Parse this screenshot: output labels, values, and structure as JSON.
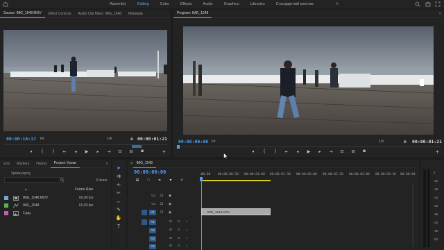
{
  "workspace": {
    "tabs": [
      {
        "label": "Assembly"
      },
      {
        "label": "Editing"
      },
      {
        "label": "Color"
      },
      {
        "label": "Effects"
      },
      {
        "label": "Audio"
      },
      {
        "label": "Graphics"
      },
      {
        "label": "Libraries"
      },
      {
        "label": "Стандартний монтаж"
      }
    ],
    "active_tab": "Editing",
    "more": "»"
  },
  "source": {
    "tabs": [
      "Source: IMG_1548.MOV",
      "Effect Controls",
      "Audio Clip Mixer: IMG_1548",
      "Metadata"
    ],
    "timecode": "00:00:16:17",
    "fit": "Fit",
    "scale": "1/4",
    "duration": "00:00:01:21"
  },
  "program": {
    "tab": "Program: IMG_1548",
    "timecode": "00:00:00:00",
    "fit": "Fit",
    "scale": "1/4",
    "duration": "00:00:01:21"
  },
  "project": {
    "tabs": [
      "ects",
      "Markers",
      "History",
      "Project: Уроки"
    ],
    "project_file": "Уроки.prproj",
    "items_count": "3 Items",
    "column_frame_rate": "Frame Rate",
    "items": [
      {
        "name": "IMG_1548.MOV",
        "frame_rate": "60,00 fps",
        "color": "#6fa9d8"
      },
      {
        "name": "IMG_1548",
        "frame_rate": "60,00 fps",
        "color": "#59b35a"
      },
      {
        "name": "1.jpg",
        "frame_rate": "",
        "color": "#c05fb5"
      }
    ]
  },
  "timeline": {
    "tab": "IMG_1548",
    "timecode": "00:00:00:00",
    "ruler": [
      ":00:00",
      "00:00:00:30",
      "00:00:01:00",
      "00:00:01:30",
      "00:00:02:00",
      "00:00:02:30",
      "00:00:03:00",
      "00:00:03:30",
      "00:00:04"
    ],
    "video_tracks": [
      "V3",
      "V2",
      "V1"
    ],
    "audio_tracks": [
      "A1",
      "A2",
      "A3",
      "A4"
    ],
    "clip_name": "IMG_1548.MOV",
    "mute": "M",
    "solo": "S"
  },
  "meter": {
    "labels": [
      "0",
      "-12",
      "-18",
      "-24",
      "-30",
      "-36",
      "-42",
      "-48",
      "-54"
    ]
  },
  "colors": {
    "accent": "#4e9ff0",
    "panel": "#232323",
    "background": "#1d1d1d"
  }
}
